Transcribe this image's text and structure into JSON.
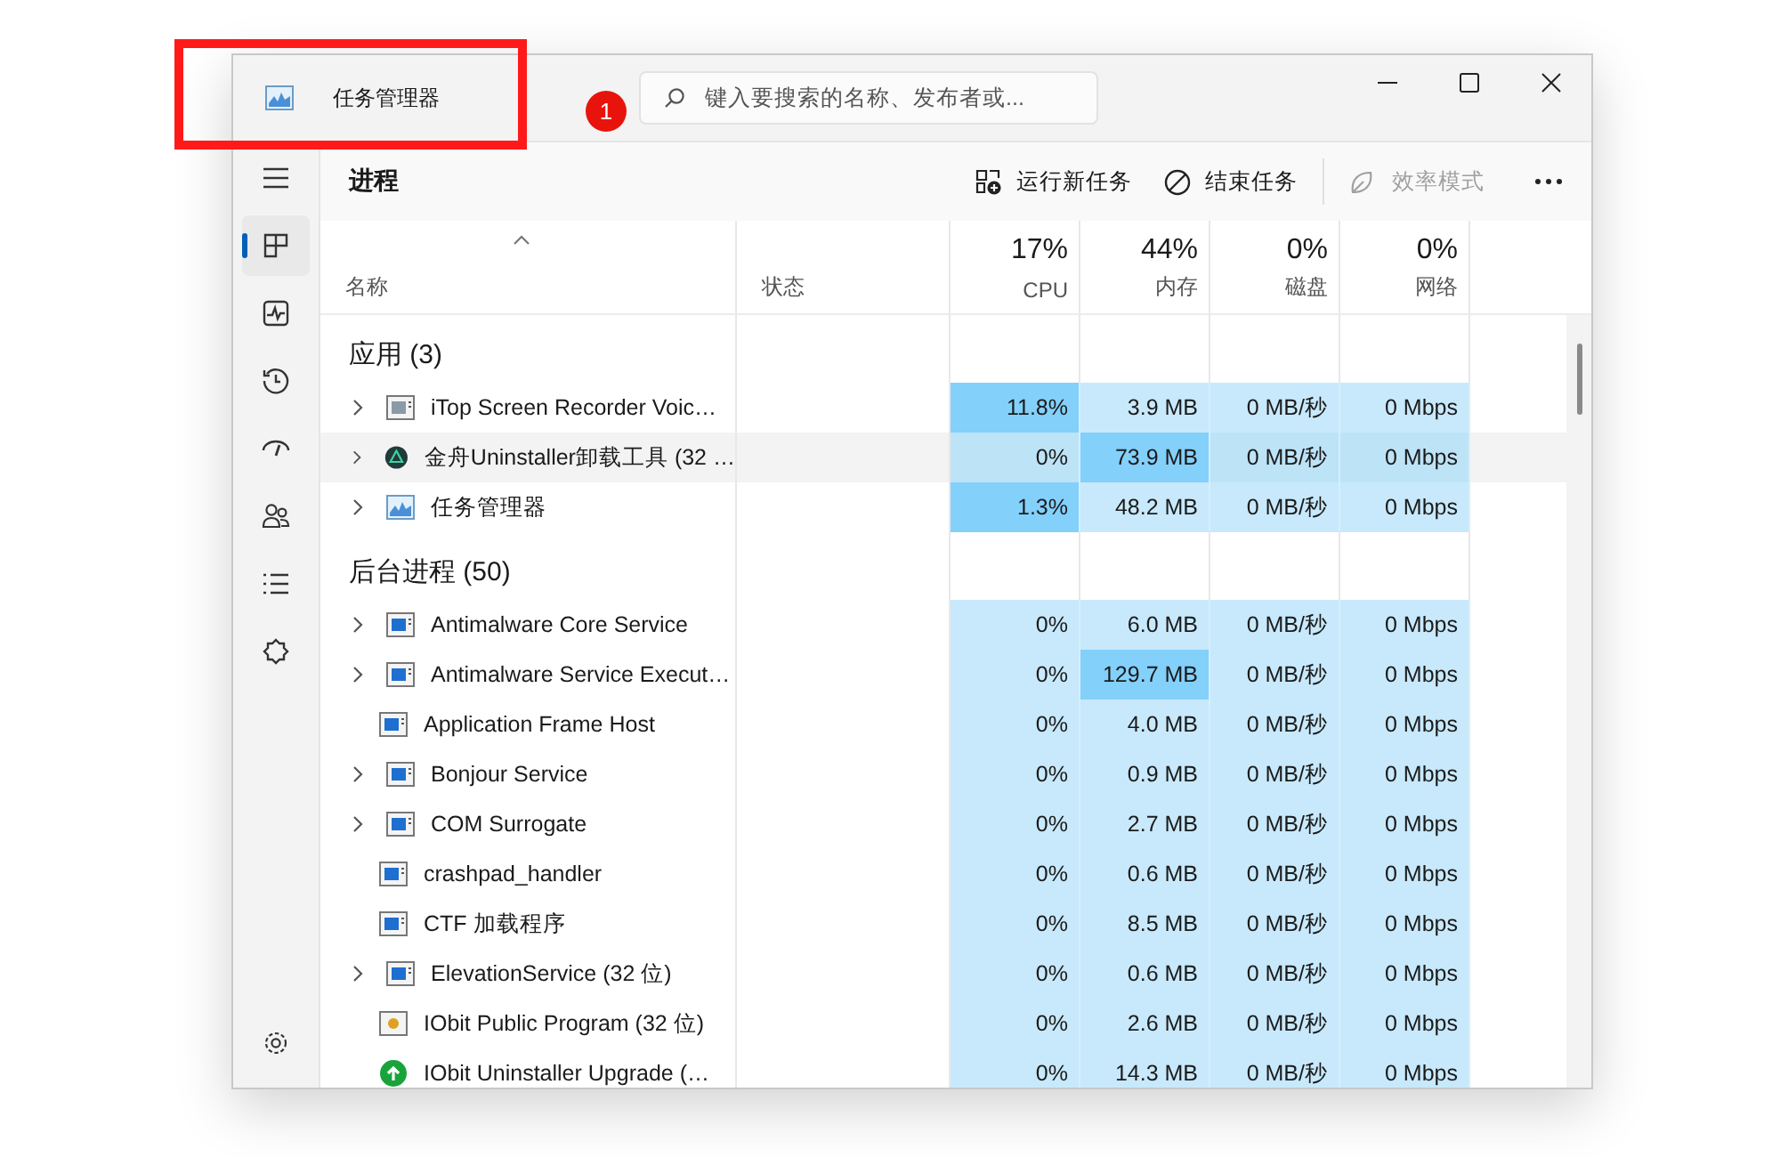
{
  "window": {
    "title": "任务管理器"
  },
  "annotation": {
    "badge": "1"
  },
  "search": {
    "placeholder": "键入要搜索的名称、发布者或..."
  },
  "nav": [
    {
      "selected": true
    },
    {
      "selected": false
    },
    {
      "selected": false
    },
    {
      "selected": false
    },
    {
      "selected": false
    },
    {
      "selected": false
    },
    {
      "selected": false
    }
  ],
  "page_title": "进程",
  "actions": [
    {
      "label": "运行新任务",
      "disabled": false
    },
    {
      "label": "结束任务",
      "disabled": false
    },
    {
      "label": "效率模式",
      "disabled": true
    }
  ],
  "columns": {
    "name": "名称",
    "status": "状态",
    "metrics": [
      {
        "percent": "17%",
        "label": "CPU"
      },
      {
        "percent": "44%",
        "label": "内存"
      },
      {
        "percent": "0%",
        "label": "磁盘"
      },
      {
        "percent": "0%",
        "label": "网络"
      }
    ]
  },
  "groups": [
    {
      "title": "应用 (3)",
      "rows": [
        {
          "name": "iTop Screen Recorder Voic…",
          "kind": "screen-app",
          "expandable": true,
          "selected": false,
          "cells": [
            {
              "text": "11.8%",
              "hot": true
            },
            {
              "text": "3.9 MB",
              "hot": false
            },
            {
              "text": "0 MB/秒",
              "hot": false
            },
            {
              "text": "0 Mbps",
              "hot": false
            }
          ]
        },
        {
          "name": "金舟Uninstaller卸载工具 (32 …",
          "kind": "circle-app",
          "expandable": true,
          "selected": true,
          "cells": [
            {
              "text": "0%",
              "hot": false
            },
            {
              "text": "73.9 MB",
              "hot": true
            },
            {
              "text": "0 MB/秒",
              "hot": false
            },
            {
              "text": "0 Mbps",
              "hot": false
            }
          ]
        },
        {
          "name": "任务管理器",
          "kind": "chart-app",
          "expandable": true,
          "selected": false,
          "cells": [
            {
              "text": "1.3%",
              "hot": true
            },
            {
              "text": "48.2 MB",
              "hot": false
            },
            {
              "text": "0 MB/秒",
              "hot": false
            },
            {
              "text": "0 Mbps",
              "hot": false
            }
          ]
        }
      ]
    },
    {
      "title": "后台进程 (50)",
      "rows": [
        {
          "name": "Antimalware Core Service",
          "kind": "window",
          "expandable": true,
          "selected": false,
          "cells": [
            {
              "text": "0%",
              "hot": false
            },
            {
              "text": "6.0 MB",
              "hot": false
            },
            {
              "text": "0 MB/秒",
              "hot": false
            },
            {
              "text": "0 Mbps",
              "hot": false
            }
          ]
        },
        {
          "name": "Antimalware Service Execut…",
          "kind": "window",
          "expandable": true,
          "selected": false,
          "cells": [
            {
              "text": "0%",
              "hot": false
            },
            {
              "text": "129.7 MB",
              "hot": true
            },
            {
              "text": "0 MB/秒",
              "hot": false
            },
            {
              "text": "0 Mbps",
              "hot": false
            }
          ]
        },
        {
          "name": "Application Frame Host",
          "kind": "window",
          "expandable": false,
          "selected": false,
          "cells": [
            {
              "text": "0%",
              "hot": false
            },
            {
              "text": "4.0 MB",
              "hot": false
            },
            {
              "text": "0 MB/秒",
              "hot": false
            },
            {
              "text": "0 Mbps",
              "hot": false
            }
          ]
        },
        {
          "name": "Bonjour Service",
          "kind": "window",
          "expandable": true,
          "selected": false,
          "cells": [
            {
              "text": "0%",
              "hot": false
            },
            {
              "text": "0.9 MB",
              "hot": false
            },
            {
              "text": "0 MB/秒",
              "hot": false
            },
            {
              "text": "0 Mbps",
              "hot": false
            }
          ]
        },
        {
          "name": "COM Surrogate",
          "kind": "window",
          "expandable": true,
          "selected": false,
          "cells": [
            {
              "text": "0%",
              "hot": false
            },
            {
              "text": "2.7 MB",
              "hot": false
            },
            {
              "text": "0 MB/秒",
              "hot": false
            },
            {
              "text": "0 Mbps",
              "hot": false
            }
          ]
        },
        {
          "name": "crashpad_handler",
          "kind": "window",
          "expandable": false,
          "selected": false,
          "cells": [
            {
              "text": "0%",
              "hot": false
            },
            {
              "text": "0.6 MB",
              "hot": false
            },
            {
              "text": "0 MB/秒",
              "hot": false
            },
            {
              "text": "0 Mbps",
              "hot": false
            }
          ]
        },
        {
          "name": "CTF 加载程序",
          "kind": "window",
          "expandable": false,
          "selected": false,
          "cells": [
            {
              "text": "0%",
              "hot": false
            },
            {
              "text": "8.5 MB",
              "hot": false
            },
            {
              "text": "0 MB/秒",
              "hot": false
            },
            {
              "text": "0 Mbps",
              "hot": false
            }
          ]
        },
        {
          "name": "ElevationService (32 位)",
          "kind": "window",
          "expandable": true,
          "selected": false,
          "cells": [
            {
              "text": "0%",
              "hot": false
            },
            {
              "text": "0.6 MB",
              "hot": false
            },
            {
              "text": "0 MB/秒",
              "hot": false
            },
            {
              "text": "0 Mbps",
              "hot": false
            }
          ]
        },
        {
          "name": "IObit Public Program (32 位)",
          "kind": "dot-app",
          "expandable": false,
          "selected": false,
          "cells": [
            {
              "text": "0%",
              "hot": false
            },
            {
              "text": "2.6 MB",
              "hot": false
            },
            {
              "text": "0 MB/秒",
              "hot": false
            },
            {
              "text": "0 Mbps",
              "hot": false
            }
          ]
        },
        {
          "name": "IObit Uninstaller Upgrade (…",
          "kind": "upgrade-app",
          "expandable": false,
          "selected": false,
          "cells": [
            {
              "text": "0%",
              "hot": false
            },
            {
              "text": "14.3 MB",
              "hot": false
            },
            {
              "text": "0 MB/秒",
              "hot": false
            },
            {
              "text": "0 Mbps",
              "hot": false
            }
          ]
        }
      ]
    }
  ]
}
